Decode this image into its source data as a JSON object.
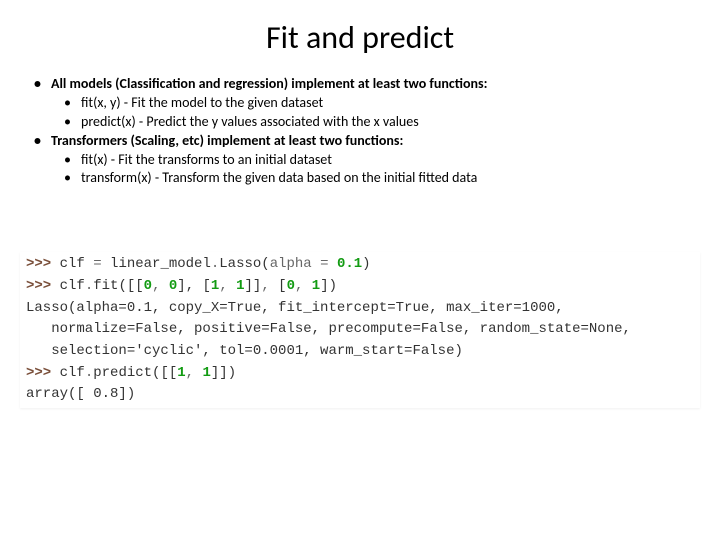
{
  "title": "Fit and predict",
  "bullets": {
    "a": "All models (Classification and regression) implement at least two functions:",
    "a1": "fit(x, y) - Fit the model to the given dataset",
    "a2": "predict(x) - Predict the y values associated with the x values",
    "b": "Transformers (Scaling, etc) implement at least two functions:",
    "b1": "fit(x) - Fit the transforms to an initial dataset",
    "b2": "transform(x) - Transform the given data based on the initial fitted data"
  },
  "code": {
    "prompt": ">>> ",
    "l1": {
      "clf": "clf",
      "eq": " = ",
      "mod": "linear_model",
      "dot": ".",
      "fn": "Lasso",
      "lp": "(",
      "kw": "alpha",
      "op": " = ",
      "val": "0.1",
      "rp": ")"
    },
    "l2": {
      "clf": "clf",
      "dot": ".",
      "fn": "fit",
      "args": "([[0, 0], [1, 1]], [0, 1])"
    },
    "l2_args_tokens": {
      "lp": "(",
      "lb1": "[[",
      "n0a": "0",
      "c1": ", ",
      "n0b": "0",
      "rb1": "], [",
      "n1a": "1",
      "c2": ", ",
      "n1b": "1",
      "rb2": "]]",
      "c3": ", ",
      "lb3": "[",
      "n0c": "0",
      "c4": ", ",
      "n1c": "1",
      "rb3": "]",
      "rp": ")"
    },
    "out1": "Lasso(alpha=0.1, copy_X=True, fit_intercept=True, max_iter=1000,",
    "out2": "   normalize=False, positive=False, precompute=False, random_state=None,",
    "out3": "   selection='cyclic', tol=0.0001, warm_start=False)",
    "l3": {
      "clf": "clf",
      "dot": ".",
      "fn": "predict",
      "args": "([[1, 1]])"
    },
    "l3_args_tokens": {
      "lp": "(",
      "lb": "[[",
      "n1a": "1",
      "c": ", ",
      "n1b": "1",
      "rb": "]]",
      "rp": ")"
    },
    "out4": "array([ 0.8])"
  }
}
